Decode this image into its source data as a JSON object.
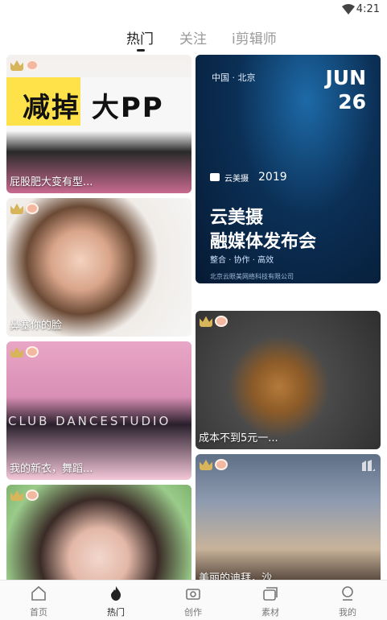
{
  "status_bar": {
    "time": "4:21"
  },
  "tabs": [
    {
      "label": "热门",
      "active": true
    },
    {
      "label": "关注",
      "active": false
    },
    {
      "label": "i剪辑师",
      "active": false
    }
  ],
  "cards": {
    "card1": {
      "caption": "屁股肥大变有型...",
      "overlay_text": "减掉 大PP"
    },
    "card2": {
      "caption": "鼻塞你的脸"
    },
    "card3": {
      "caption": "我的新衣，舞蹈...",
      "overlay_text": "CLUB DANCESTUDIO"
    },
    "card4": {},
    "poster": {
      "location": "中国 · 北京",
      "month": "JUN",
      "day": "26",
      "brand": "云美摄",
      "year": "2019",
      "title_line1": "云美摄",
      "title_line2": "融媒体发布会",
      "subtitle": "整合 · 协作 · 高效",
      "footer": "北京云眼美网络科技有限公司"
    },
    "card6": {
      "caption": "成本不到5元一..."
    },
    "card7": {
      "caption": "美丽的迪拜，沙..."
    }
  },
  "bottom_nav": [
    {
      "label": "首页",
      "icon": "home-icon",
      "active": false
    },
    {
      "label": "热门",
      "icon": "flame-icon",
      "active": true
    },
    {
      "label": "创作",
      "icon": "camera-icon",
      "active": false
    },
    {
      "label": "素材",
      "icon": "material-icon",
      "active": false
    },
    {
      "label": "我的",
      "icon": "profile-icon",
      "active": false
    }
  ],
  "colors": {
    "accent": "#222222",
    "inactive": "#9a9a9a",
    "crown": "#d8b45a"
  }
}
